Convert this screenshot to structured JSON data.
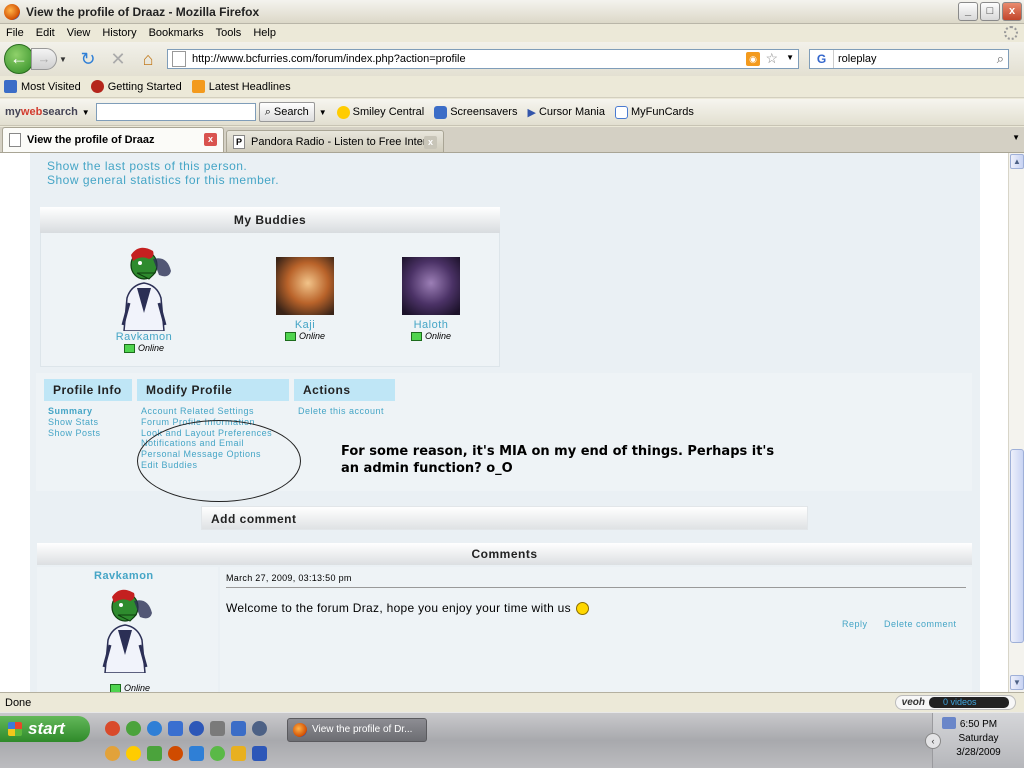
{
  "window": {
    "title": "View the profile of Draaz - Mozilla Firefox",
    "buttons": {
      "minimize": "_",
      "maximize": "□",
      "close": "x"
    }
  },
  "menu": [
    "File",
    "Edit",
    "View",
    "History",
    "Bookmarks",
    "Tools",
    "Help"
  ],
  "nav": {
    "url": "http://www.bcfurries.com/forum/index.php?action=profile",
    "search_value": "roleplay",
    "search_engine": "G"
  },
  "bookmarks": [
    {
      "label": "Most Visited",
      "color": "#3b6dc7"
    },
    {
      "label": "Getting Started",
      "color": "#b5261c"
    },
    {
      "label": "Latest Headlines",
      "color": "#f39a1d"
    }
  ],
  "mywebsearch": {
    "logo_prefix": "my",
    "logo_bold": "web",
    "logo_suffix": "search",
    "search_label": "Search",
    "items": [
      {
        "label": "Smiley Central",
        "color": "#ffcc00"
      },
      {
        "label": "Screensavers",
        "color": "#3b6dc7"
      },
      {
        "label": "Cursor Mania",
        "color": "#3355aa"
      },
      {
        "label": "MyFunCards",
        "color": "#4a7bd1"
      }
    ]
  },
  "tabs": [
    {
      "label": "View the profile of Draaz",
      "active": true,
      "icon": ""
    },
    {
      "label": "Pandora Radio - Listen to Free Internet...",
      "active": false,
      "icon": "P"
    }
  ],
  "page": {
    "top_links": [
      "Show the last posts of this person.",
      "Show general statistics for this member."
    ],
    "buddies": {
      "title": "My Buddies",
      "list": [
        {
          "name": "Ravkamon",
          "status": "Online"
        },
        {
          "name": "Kaji",
          "status": "Online"
        },
        {
          "name": "Haloth",
          "status": "Online"
        }
      ]
    },
    "profile_tabs": {
      "profile_info": {
        "title": "Profile Info",
        "links": [
          "Summary",
          "Show Stats",
          "Show Posts"
        ]
      },
      "modify_profile": {
        "title": "Modify Profile",
        "links": [
          "Account Related Settings",
          "Forum Profile Information",
          "Look and Layout Preferences",
          "Notifications and Email",
          "Personal Message Options",
          "Edit Buddies"
        ]
      },
      "actions": {
        "title": "Actions",
        "links": [
          "Delete this account"
        ]
      }
    },
    "annotation": "For some reason, it's MIA on my end of things. Perhaps it's an admin function? o_O",
    "add_comment": "Add comment",
    "comments": {
      "title": "Comments",
      "items": [
        {
          "author": "Ravkamon",
          "date": "March 27, 2009, 03:13:50 pm",
          "text": "Welcome to the forum Draz, hope you enjoy your time with us",
          "status": "Online",
          "reply": "Reply",
          "delete": "Delete comment"
        }
      ]
    }
  },
  "status": {
    "text": "Done",
    "veoh_logo": "veoh",
    "veoh_videos": "0 videos"
  },
  "taskbar": {
    "start": "start",
    "window_item": "View the profile of Dr...",
    "time": "6:50 PM",
    "day": "Saturday",
    "date": "3/28/2009"
  },
  "colors": {
    "link": "#45a5c6",
    "tab_blue": "#bfe6f6",
    "forum_bg": "#eaf0f4"
  }
}
